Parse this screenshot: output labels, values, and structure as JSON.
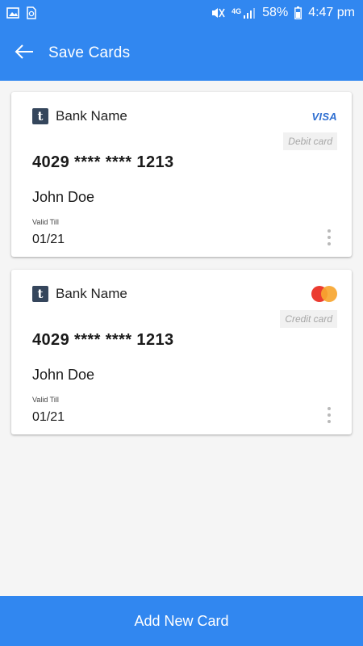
{
  "status_bar": {
    "signal_label": "4G",
    "battery_percent": "58%",
    "time": "4:47 pm",
    "icons": [
      "gallery-icon",
      "sync-image-icon",
      "mute-icon",
      "signal-icon",
      "battery-icon"
    ]
  },
  "app_bar": {
    "title": "Save Cards",
    "back_icon": "arrow-left-icon"
  },
  "cards": [
    {
      "bank_logo_letter": "t",
      "bank_name": "Bank Name",
      "brand": "VISA",
      "type": "Debit card",
      "number": "4029 **** **** 1213",
      "holder": "John Doe",
      "valid_label": "Valid Till",
      "valid_value": "01/21"
    },
    {
      "bank_logo_letter": "t",
      "bank_name": "Bank Name",
      "brand": "mastercard-logo",
      "type": "Credit card",
      "number": "4029 **** **** 1213",
      "holder": "John Doe",
      "valid_label": "Valid Till",
      "valid_value": "01/21"
    }
  ],
  "footer": {
    "add_button_label": "Add New Card"
  },
  "colors": {
    "primary": "#3187f0",
    "background": "#f5f5f5",
    "card": "#ffffff",
    "visa": "#2f6fd1",
    "mastercard_red": "#eb3b30",
    "mastercard_orange": "#f7a630"
  }
}
